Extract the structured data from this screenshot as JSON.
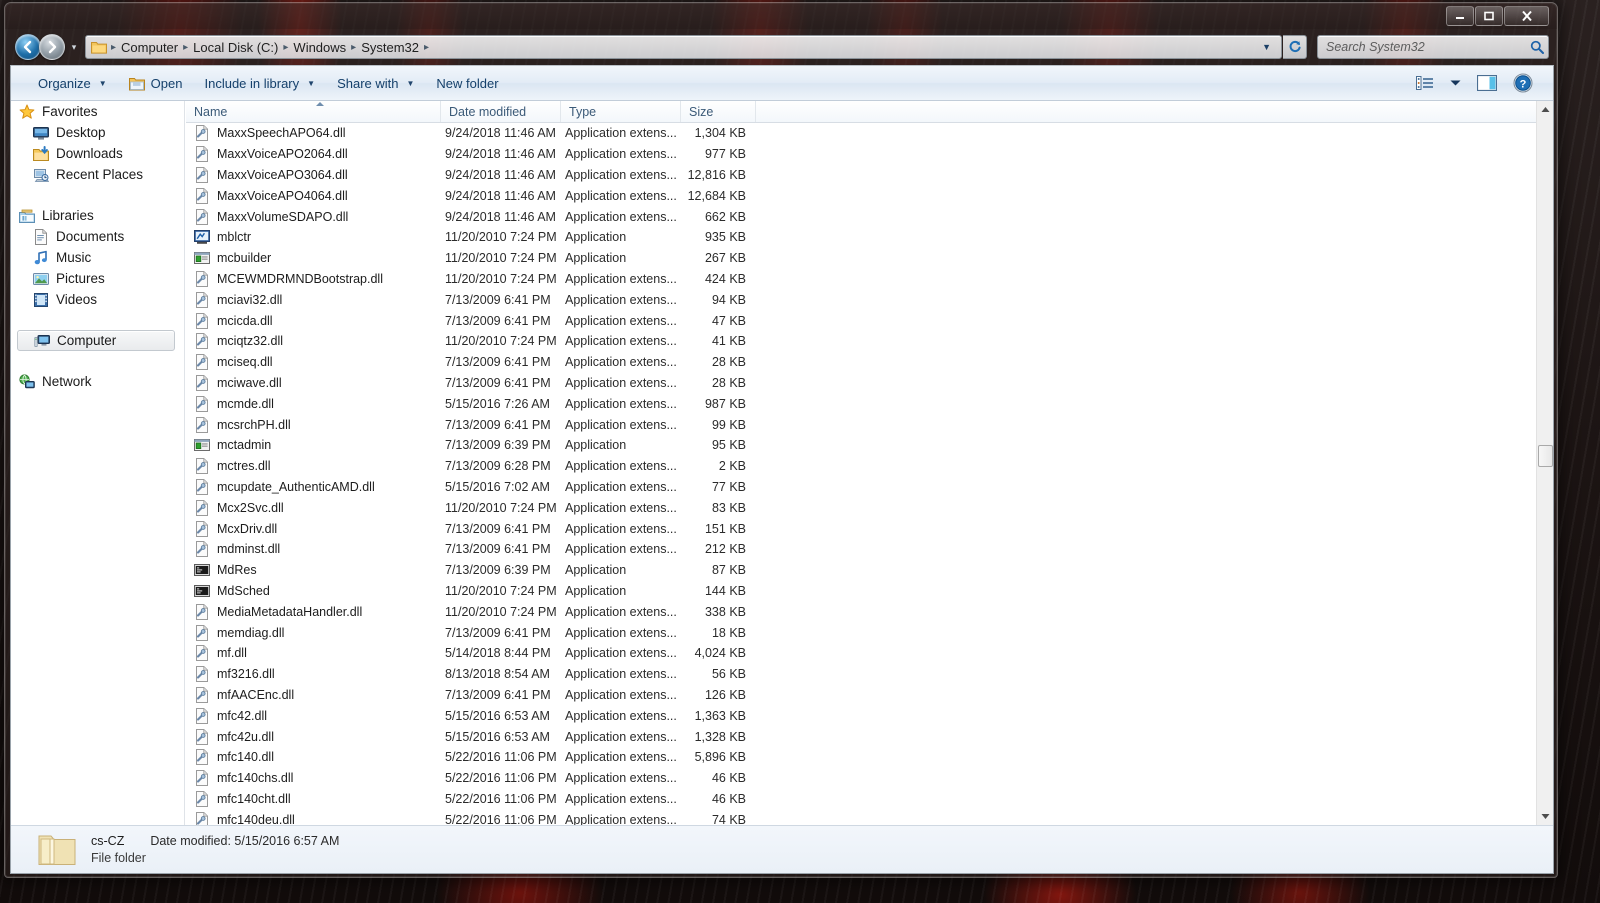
{
  "window": {
    "controls": {
      "minimize": "Minimize",
      "maximize": "Maximize",
      "close": "Close"
    }
  },
  "address": {
    "back": "Back",
    "forward": "Forward",
    "history_caret": "▾",
    "crumbs": [
      "Computer",
      "Local Disk (C:)",
      "Windows",
      "System32"
    ],
    "separator": "▸",
    "dropdown_caret": "▼",
    "refresh": "Refresh"
  },
  "search": {
    "placeholder": "Search System32",
    "value": ""
  },
  "toolbar": {
    "organize": "Organize",
    "open": "Open",
    "include_in_library": "Include in library",
    "share_with": "Share with",
    "new_folder": "New folder",
    "caret": "▼",
    "view_label": "Change your view",
    "preview_label": "Show the preview pane",
    "help_label": "Get help"
  },
  "navpane": {
    "groups": [
      {
        "root": {
          "label": "Favorites",
          "icon": "star-icon"
        },
        "items": [
          {
            "label": "Desktop",
            "icon": "desktop-icon"
          },
          {
            "label": "Downloads",
            "icon": "downloads-icon"
          },
          {
            "label": "Recent Places",
            "icon": "recent-places-icon"
          }
        ]
      },
      {
        "root": {
          "label": "Libraries",
          "icon": "libraries-icon"
        },
        "items": [
          {
            "label": "Documents",
            "icon": "documents-icon"
          },
          {
            "label": "Music",
            "icon": "music-icon"
          },
          {
            "label": "Pictures",
            "icon": "pictures-icon"
          },
          {
            "label": "Videos",
            "icon": "videos-icon"
          }
        ]
      },
      {
        "root": {
          "label": "Computer",
          "icon": "computer-icon",
          "selected": true
        },
        "items": []
      },
      {
        "root": {
          "label": "Network",
          "icon": "network-icon"
        },
        "items": []
      }
    ]
  },
  "filelist": {
    "columns": [
      "Name",
      "Date modified",
      "Type",
      "Size"
    ],
    "sorted_by": "Name",
    "sort_direction": "ascending",
    "rows": [
      {
        "name": "MaxxSpeechAPO64.dll",
        "date": "9/24/2018 11:46 AM",
        "type": "Application extens...",
        "size": "1,304 KB",
        "icon": "dll-icon"
      },
      {
        "name": "MaxxVoiceAPO2064.dll",
        "date": "9/24/2018 11:46 AM",
        "type": "Application extens...",
        "size": "977 KB",
        "icon": "dll-icon"
      },
      {
        "name": "MaxxVoiceAPO3064.dll",
        "date": "9/24/2018 11:46 AM",
        "type": "Application extens...",
        "size": "12,816 KB",
        "icon": "dll-icon"
      },
      {
        "name": "MaxxVoiceAPO4064.dll",
        "date": "9/24/2018 11:46 AM",
        "type": "Application extens...",
        "size": "12,684 KB",
        "icon": "dll-icon"
      },
      {
        "name": "MaxxVolumeSDAPO.dll",
        "date": "9/24/2018 11:46 AM",
        "type": "Application extens...",
        "size": "662 KB",
        "icon": "dll-icon"
      },
      {
        "name": "mblctr",
        "date": "11/20/2010 7:24 PM",
        "type": "Application",
        "size": "935 KB",
        "icon": "app-mblctr-icon"
      },
      {
        "name": "mcbuilder",
        "date": "11/20/2010 7:24 PM",
        "type": "Application",
        "size": "267 KB",
        "icon": "app-green-icon"
      },
      {
        "name": "MCEWMDRMNDBootstrap.dll",
        "date": "11/20/2010 7:24 PM",
        "type": "Application extens...",
        "size": "424 KB",
        "icon": "dll-icon"
      },
      {
        "name": "mciavi32.dll",
        "date": "7/13/2009 6:41 PM",
        "type": "Application extens...",
        "size": "94 KB",
        "icon": "dll-icon"
      },
      {
        "name": "mcicda.dll",
        "date": "7/13/2009 6:41 PM",
        "type": "Application extens...",
        "size": "47 KB",
        "icon": "dll-icon"
      },
      {
        "name": "mciqtz32.dll",
        "date": "11/20/2010 7:24 PM",
        "type": "Application extens...",
        "size": "41 KB",
        "icon": "dll-icon"
      },
      {
        "name": "mciseq.dll",
        "date": "7/13/2009 6:41 PM",
        "type": "Application extens...",
        "size": "28 KB",
        "icon": "dll-icon"
      },
      {
        "name": "mciwave.dll",
        "date": "7/13/2009 6:41 PM",
        "type": "Application extens...",
        "size": "28 KB",
        "icon": "dll-icon"
      },
      {
        "name": "mcmde.dll",
        "date": "5/15/2016 7:26 AM",
        "type": "Application extens...",
        "size": "987 KB",
        "icon": "dll-icon"
      },
      {
        "name": "mcsrchPH.dll",
        "date": "7/13/2009 6:41 PM",
        "type": "Application extens...",
        "size": "99 KB",
        "icon": "dll-icon"
      },
      {
        "name": "mctadmin",
        "date": "7/13/2009 6:39 PM",
        "type": "Application",
        "size": "95 KB",
        "icon": "app-green-icon"
      },
      {
        "name": "mctres.dll",
        "date": "7/13/2009 6:28 PM",
        "type": "Application extens...",
        "size": "2 KB",
        "icon": "dll-icon"
      },
      {
        "name": "mcupdate_AuthenticAMD.dll",
        "date": "5/15/2016 7:02 AM",
        "type": "Application extens...",
        "size": "77 KB",
        "icon": "dll-icon"
      },
      {
        "name": "Mcx2Svc.dll",
        "date": "11/20/2010 7:24 PM",
        "type": "Application extens...",
        "size": "83 KB",
        "icon": "dll-icon"
      },
      {
        "name": "McxDriv.dll",
        "date": "7/13/2009 6:41 PM",
        "type": "Application extens...",
        "size": "151 KB",
        "icon": "dll-icon"
      },
      {
        "name": "mdminst.dll",
        "date": "7/13/2009 6:41 PM",
        "type": "Application extens...",
        "size": "212 KB",
        "icon": "dll-icon"
      },
      {
        "name": "MdRes",
        "date": "7/13/2009 6:39 PM",
        "type": "Application",
        "size": "87 KB",
        "icon": "app-console-icon"
      },
      {
        "name": "MdSched",
        "date": "11/20/2010 7:24 PM",
        "type": "Application",
        "size": "144 KB",
        "icon": "app-console-icon"
      },
      {
        "name": "MediaMetadataHandler.dll",
        "date": "11/20/2010 7:24 PM",
        "type": "Application extens...",
        "size": "338 KB",
        "icon": "dll-icon"
      },
      {
        "name": "memdiag.dll",
        "date": "7/13/2009 6:41 PM",
        "type": "Application extens...",
        "size": "18 KB",
        "icon": "dll-icon"
      },
      {
        "name": "mf.dll",
        "date": "5/14/2018 8:44 PM",
        "type": "Application extens...",
        "size": "4,024 KB",
        "icon": "dll-icon"
      },
      {
        "name": "mf3216.dll",
        "date": "8/13/2018 8:54 AM",
        "type": "Application extens...",
        "size": "56 KB",
        "icon": "dll-icon"
      },
      {
        "name": "mfAACEnc.dll",
        "date": "7/13/2009 6:41 PM",
        "type": "Application extens...",
        "size": "126 KB",
        "icon": "dll-icon"
      },
      {
        "name": "mfc42.dll",
        "date": "5/15/2016 6:53 AM",
        "type": "Application extens...",
        "size": "1,363 KB",
        "icon": "dll-icon"
      },
      {
        "name": "mfc42u.dll",
        "date": "5/15/2016 6:53 AM",
        "type": "Application extens...",
        "size": "1,328 KB",
        "icon": "dll-icon"
      },
      {
        "name": "mfc140.dll",
        "date": "5/22/2016 11:06 PM",
        "type": "Application extens...",
        "size": "5,896 KB",
        "icon": "dll-icon"
      },
      {
        "name": "mfc140chs.dll",
        "date": "5/22/2016 11:06 PM",
        "type": "Application extens...",
        "size": "46 KB",
        "icon": "dll-icon"
      },
      {
        "name": "mfc140cht.dll",
        "date": "5/22/2016 11:06 PM",
        "type": "Application extens...",
        "size": "46 KB",
        "icon": "dll-icon"
      },
      {
        "name": "mfc140deu.dll",
        "date": "5/22/2016 11:06 PM",
        "type": "Application extens...",
        "size": "74 KB",
        "icon": "dll-icon"
      }
    ]
  },
  "details": {
    "name": "cs-CZ",
    "date_label": "Date modified:",
    "date_value": "5/15/2016 6:57 AM",
    "kind": "File folder"
  },
  "colors": {
    "accent": "#15406b",
    "header_text": "#3b5a78",
    "selection_border": "#c3c9cf"
  }
}
